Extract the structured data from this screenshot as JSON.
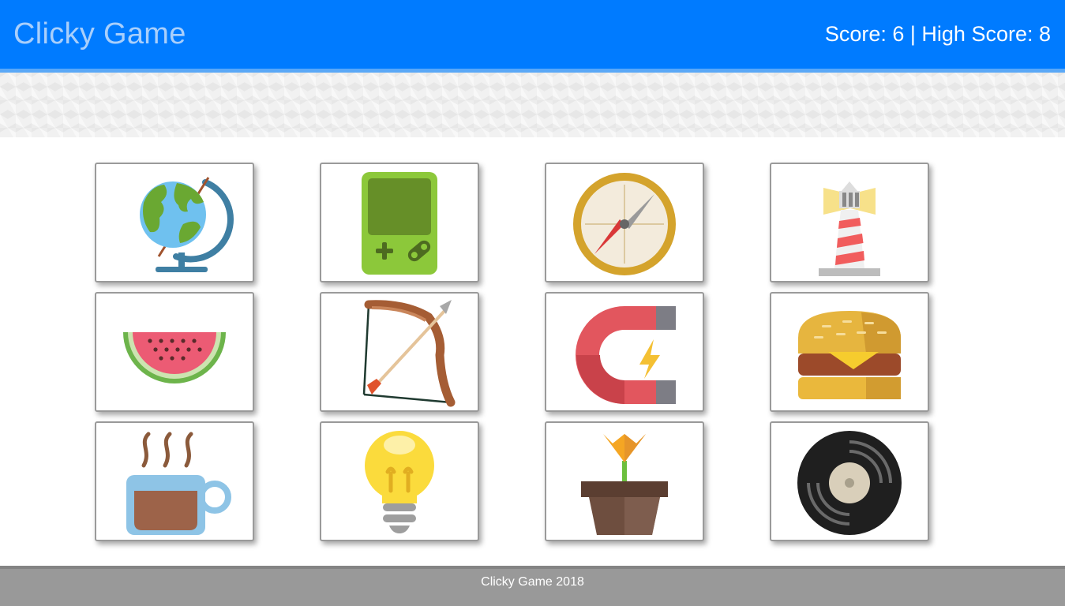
{
  "navbar": {
    "brand": "Clicky Game",
    "score_text": "Score: 6 | High Score: 8"
  },
  "cards": [
    {
      "icon": "globe-icon"
    },
    {
      "icon": "handheld-game-console-icon"
    },
    {
      "icon": "compass-icon"
    },
    {
      "icon": "lighthouse-icon"
    },
    {
      "icon": "watermelon-icon"
    },
    {
      "icon": "bow-and-arrow-icon"
    },
    {
      "icon": "magnet-icon"
    },
    {
      "icon": "hamburger-icon"
    },
    {
      "icon": "coffee-cup-icon"
    },
    {
      "icon": "light-bulb-icon"
    },
    {
      "icon": "flower-pot-icon"
    },
    {
      "icon": "vinyl-record-icon"
    }
  ],
  "footer": {
    "text": "Clicky Game 2018"
  },
  "colors": {
    "navbar": "#007bff",
    "brand_text": "#a9cffb",
    "footer": "#999999"
  }
}
